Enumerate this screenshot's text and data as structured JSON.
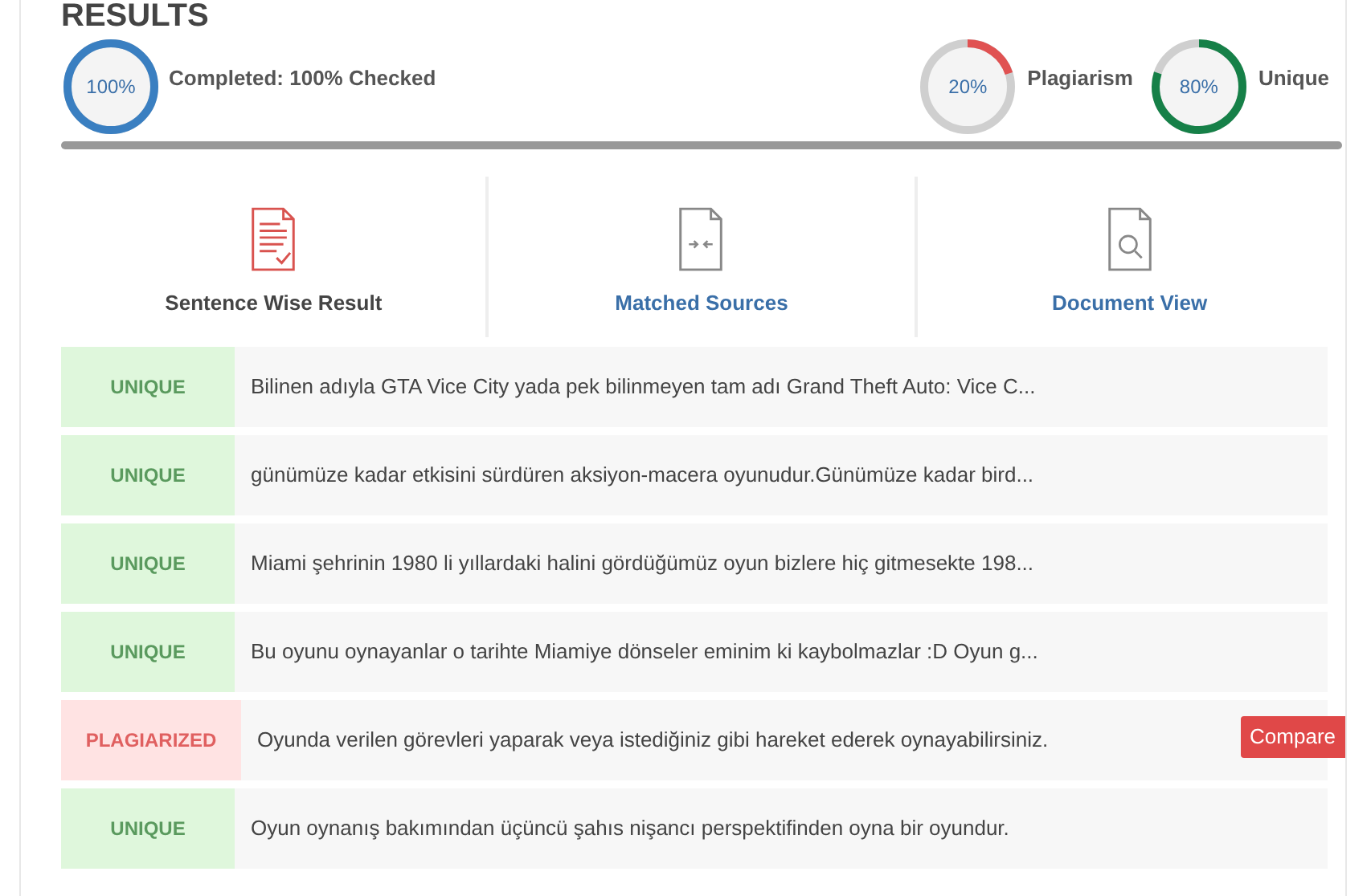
{
  "title": "RESULTS",
  "progress": {
    "reading": "100%",
    "level": 1,
    "label": "Completed: 100% Checked"
  },
  "scores": [
    {
      "reading": "20%",
      "level": 0.2,
      "label": "Plagiarism",
      "color": "#e05252"
    },
    {
      "reading": "80%",
      "level": 0.8,
      "label": "Unique",
      "color": "#168048"
    }
  ],
  "tabs": [
    {
      "label": "Sentence Wise Result",
      "selected": true,
      "kind": "sentences"
    },
    {
      "label": "Matched Sources",
      "selected": false,
      "kind": "sources"
    },
    {
      "label": "Document View",
      "selected": false,
      "kind": "document"
    }
  ],
  "rows": [
    {
      "kind": "unique",
      "status": "UNIQUE",
      "text": "Bilinen adıyla GTA Vice City yada pek bilinmeyen tam adı Grand Theft Auto: Vice C..."
    },
    {
      "kind": "unique",
      "status": "UNIQUE",
      "text": "günümüze kadar etkisini sürdüren aksiyon-macera oyunudur.Günümüze kadar bird..."
    },
    {
      "kind": "unique",
      "status": "UNIQUE",
      "text": "Miami şehrinin 1980 li yıllardaki halini gördüğümüz oyun bizlere hiç gitmesekte 198..."
    },
    {
      "kind": "unique",
      "status": "UNIQUE",
      "text": "Bu oyunu oynayanlar o tarihte Miamiye dönseler eminim ki kaybolmazlar :D Oyun g..."
    },
    {
      "kind": "plagiarized",
      "status": "PLAGIARIZED",
      "text": "Oyunda verilen görevleri yaparak veya istediğiniz gibi hareket ederek oynayabilirsiniz.",
      "action": "Compare"
    },
    {
      "kind": "unique",
      "status": "UNIQUE",
      "text": "Oyun oynanış bakımından üçüncü şahıs nişancı perspektifinden oyna bir oyundur."
    }
  ]
}
